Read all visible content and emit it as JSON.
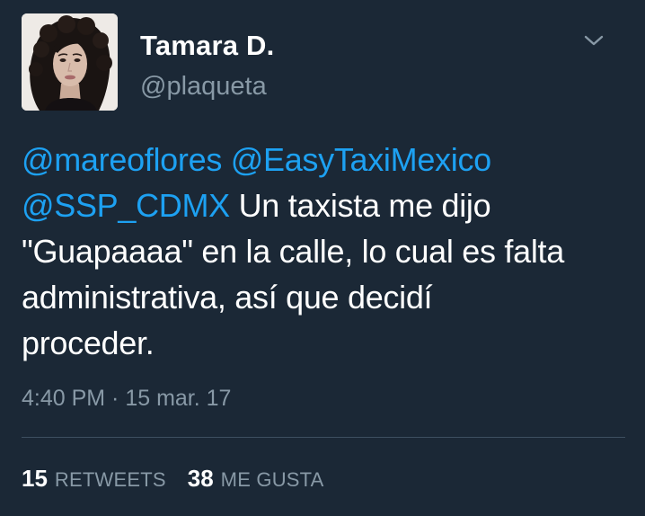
{
  "author": {
    "name": "Tamara D.",
    "handle": "@plaqueta"
  },
  "tweet": {
    "mention_1": "@mareoflores",
    "mention_2": "@EasyTaxiMexico",
    "mention_3": "@SSP_CDMX",
    "text_line_1": " Un taxista me dijo",
    "text_line_2": "\"Guapaaaa\" en la calle, lo cual es falta",
    "text_line_3": "administrativa, así que decidí",
    "text_line_4": "proceder.",
    "timestamp": "4:40 PM · 15 mar. 17"
  },
  "stats": {
    "retweets_count": "15",
    "retweets_label": "RETWEETS",
    "likes_count": "38",
    "likes_label": "ME GUSTA"
  },
  "icons": {
    "menu": "chevron-down-icon"
  },
  "colors": {
    "background": "#1b2836",
    "mention": "#1da1f2",
    "muted": "#8899a6",
    "text": "#ffffff"
  }
}
